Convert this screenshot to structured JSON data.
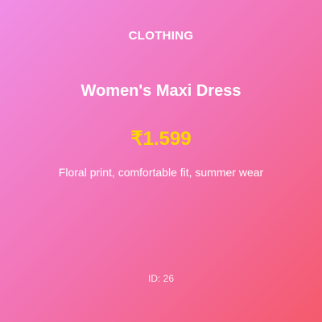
{
  "product": {
    "category": "CLOTHING",
    "title": "Women's Maxi Dress",
    "price": "₹1.599",
    "description": "Floral print, comfortable fit, summer wear",
    "id_label": "ID: 26"
  },
  "colors": {
    "gradient_start": "#f08ee6",
    "gradient_mid": "#f273b4",
    "gradient_end": "#f55a6c",
    "price_color": "#ffd700",
    "text_color": "#ffffff"
  }
}
